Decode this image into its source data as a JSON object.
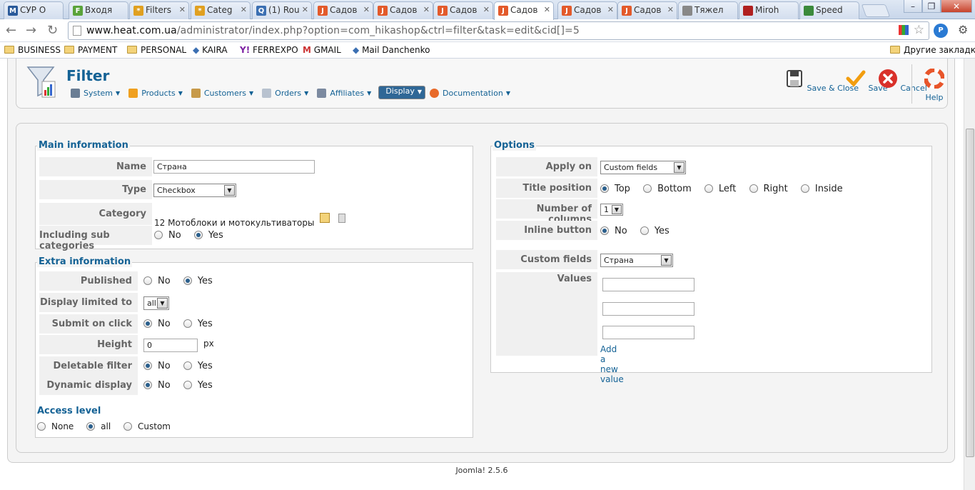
{
  "browser": {
    "tabs": [
      {
        "label": "СУР О",
        "icon_color": "#2a5a9a",
        "icon": "M"
      },
      {
        "label": "Входя",
        "icon_color": "#5aa33a",
        "icon": "F"
      },
      {
        "label": "Filters",
        "icon_color": "#e0a020",
        "icon": "*"
      },
      {
        "label": "Categ",
        "icon_color": "#e0a020",
        "icon": "*"
      },
      {
        "label": "(1) Rou",
        "icon_color": "#3b6fb2",
        "icon": "Q"
      },
      {
        "label": "Садов",
        "icon_color": "#e35a2b",
        "icon": "J"
      },
      {
        "label": "Садов",
        "icon_color": "#e35a2b",
        "icon": "J"
      },
      {
        "label": "Садов",
        "icon_color": "#e35a2b",
        "icon": "J"
      },
      {
        "label": "Садов",
        "icon_color": "#e35a2b",
        "icon": "J",
        "active": true
      },
      {
        "label": "Садов",
        "icon_color": "#e35a2b",
        "icon": "J"
      },
      {
        "label": "Садов",
        "icon_color": "#e35a2b",
        "icon": "J"
      },
      {
        "label": "Тяжел",
        "icon_color": "#888888",
        "icon": ""
      },
      {
        "label": "Miroh",
        "icon_color": "#b02020",
        "icon": ""
      },
      {
        "label": "Speed",
        "icon_color": "#3b8a3b",
        "icon": ""
      }
    ],
    "url_host": "www.heat.com.ua",
    "url_path": "/administrator/index.php?option=com_hikashop&ctrl=filter&task=edit&cid[]=5",
    "bookmarks": [
      "BUSINESS",
      "PAYMENT",
      "PERSONAL",
      "KAIRA",
      "FERREXPO",
      "GMAIL",
      "Mail Danchenko"
    ],
    "other_bookmarks": "Другие закладки"
  },
  "header": {
    "title": "Filter",
    "menu": [
      "System",
      "Products",
      "Customers",
      "Orders",
      "Affiliates",
      "Display",
      "Documentation"
    ],
    "actions": [
      "Save & Close",
      "Save",
      "Cancel",
      "Help"
    ]
  },
  "main_info": {
    "legend": "Main information",
    "name_label": "Name",
    "name_value": "Страна",
    "type_label": "Type",
    "type_value": "Checkbox",
    "category_label": "Category",
    "category_value": "12 Мотоблоки и мотокультиваторы",
    "subcat_label": "Including sub categories",
    "no": "No",
    "yes": "Yes"
  },
  "extra_info": {
    "legend": "Extra information",
    "published_label": "Published",
    "display_limited_label": "Display limited to",
    "display_limited_value": "all",
    "submit_label": "Submit on click",
    "height_label": "Height",
    "height_value": "0",
    "height_unit": "px",
    "deletable_label": "Deletable filter",
    "dynamic_label": "Dynamic display",
    "access_legend": "Access level",
    "access_none": "None",
    "access_all": "all",
    "access_custom": "Custom"
  },
  "options": {
    "legend": "Options",
    "apply_on_label": "Apply on",
    "apply_on_value": "Custom fields",
    "title_position_label": "Title position",
    "positions": [
      "Top",
      "Bottom",
      "Left",
      "Right",
      "Inside"
    ],
    "columns_label": "Number of columns",
    "columns_value": "1",
    "inline_label": "Inline button",
    "custom_fields_label": "Custom fields",
    "custom_fields_value": "Страна",
    "values_label": "Values",
    "add_value": "Add a new value"
  },
  "footer": {
    "version": "Joomla! 2.5.6"
  }
}
